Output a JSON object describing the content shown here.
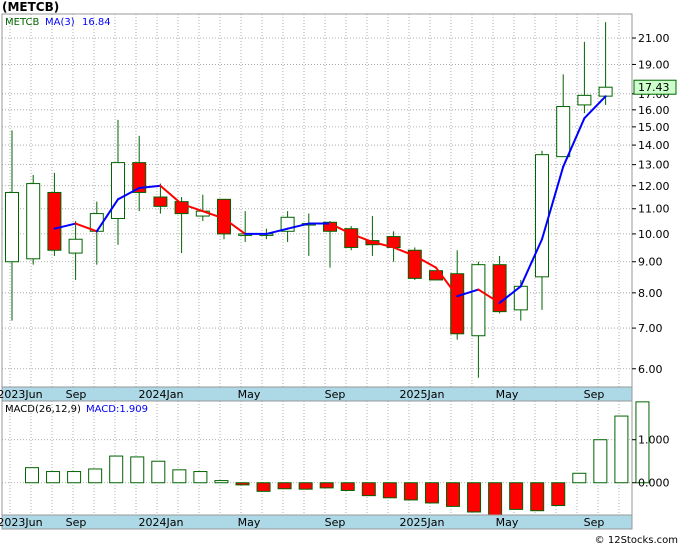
{
  "chart_data": {
    "type": "candlestick",
    "title": "(METCB)",
    "footer": "© 12Stocks.com",
    "x_labels": [
      "2023Jun",
      "Sep",
      "2024Jan",
      "May",
      "Sep",
      "2025Jan",
      "May",
      "Sep"
    ],
    "price_panel": {
      "y_scale": "log",
      "ylim": [
        5.6,
        23.0
      ],
      "y_ticks": [
        "21.00",
        "19.00",
        "17.00",
        "16.00",
        "15.00",
        "14.00",
        "13.00",
        "12.00",
        "11.00",
        "10.00",
        "9.00",
        "8.00",
        "7.00",
        "6.00"
      ],
      "current_price": "17.43",
      "legend": {
        "ticker": "METCB",
        "ma_label": "MA(3)",
        "ma_value": "16.84"
      },
      "colors": {
        "up": "#ffffff",
        "down": "#ff0000",
        "outline": "#006400",
        "ma_up": "#0000ff",
        "ma_down": "#ff0000"
      },
      "candles": [
        {
          "o": 9.0,
          "h": 14.8,
          "l": 7.2,
          "c": 11.7
        },
        {
          "o": 9.1,
          "h": 12.5,
          "l": 8.9,
          "c": 12.1
        },
        {
          "o": 11.7,
          "h": 12.6,
          "l": 9.2,
          "c": 9.4
        },
        {
          "o": 9.3,
          "h": 10.5,
          "l": 8.4,
          "c": 9.8
        },
        {
          "o": 10.1,
          "h": 11.3,
          "l": 8.9,
          "c": 10.8
        },
        {
          "o": 10.6,
          "h": 15.4,
          "l": 9.6,
          "c": 13.1
        },
        {
          "o": 13.1,
          "h": 14.5,
          "l": 10.9,
          "c": 11.7
        },
        {
          "o": 11.5,
          "h": 12.1,
          "l": 10.8,
          "c": 11.1
        },
        {
          "o": 11.3,
          "h": 11.5,
          "l": 9.3,
          "c": 10.8
        },
        {
          "o": 10.7,
          "h": 11.6,
          "l": 10.5,
          "c": 10.9
        },
        {
          "o": 11.4,
          "h": 11.4,
          "l": 9.8,
          "c": 10.0
        },
        {
          "o": 9.98,
          "h": 10.9,
          "l": 9.7,
          "c": 10.0
        },
        {
          "o": 9.95,
          "h": 10.2,
          "l": 9.8,
          "c": 10.0
        },
        {
          "o": 10.1,
          "h": 10.9,
          "l": 9.7,
          "c": 10.65
        },
        {
          "o": 10.4,
          "h": 10.8,
          "l": 9.2,
          "c": 10.4
        },
        {
          "o": 10.45,
          "h": 10.5,
          "l": 8.8,
          "c": 10.1
        },
        {
          "o": 10.2,
          "h": 10.3,
          "l": 9.4,
          "c": 9.5
        },
        {
          "o": 9.75,
          "h": 10.7,
          "l": 9.2,
          "c": 9.6
        },
        {
          "o": 9.9,
          "h": 10.1,
          "l": 9.0,
          "c": 9.5
        },
        {
          "o": 9.4,
          "h": 9.5,
          "l": 8.4,
          "c": 8.45
        },
        {
          "o": 8.7,
          "h": 8.7,
          "l": 8.4,
          "c": 8.4
        },
        {
          "o": 8.6,
          "h": 9.4,
          "l": 6.7,
          "c": 6.85
        },
        {
          "o": 6.8,
          "h": 9.0,
          "l": 5.8,
          "c": 8.9
        },
        {
          "o": 8.9,
          "h": 9.2,
          "l": 7.4,
          "c": 7.45
        },
        {
          "o": 7.5,
          "h": 8.4,
          "l": 7.2,
          "c": 8.2
        },
        {
          "o": 8.5,
          "h": 13.7,
          "l": 7.5,
          "c": 13.5
        },
        {
          "o": 13.4,
          "h": 18.3,
          "l": 13.4,
          "c": 16.2
        },
        {
          "o": 16.3,
          "h": 20.7,
          "l": 15.8,
          "c": 16.9
        },
        {
          "o": 16.85,
          "h": 22.3,
          "l": 16.3,
          "c": 17.43
        }
      ],
      "ma": [
        null,
        null,
        10.2,
        10.4,
        10.1,
        11.4,
        11.9,
        12.0,
        11.2,
        10.9,
        10.6,
        10.0,
        10.0,
        10.2,
        10.4,
        10.4,
        10.0,
        9.7,
        9.5,
        9.2,
        8.8,
        7.9,
        8.1,
        7.7,
        8.2,
        9.8,
        12.9,
        15.5,
        16.84
      ]
    },
    "macd_panel": {
      "label": "MACD(26,12,9)",
      "macd_label": "MACD:1.909",
      "ylim": [
        -0.75,
        1.9
      ],
      "y_ticks": [
        "1.000",
        "0.000"
      ],
      "colors": {
        "positive": "#ffffff",
        "negative": "#ff0000",
        "outline": "#006400"
      },
      "values": [
        0.35,
        0.26,
        0.26,
        0.32,
        0.62,
        0.6,
        0.5,
        0.3,
        0.26,
        0.05,
        -0.05,
        -0.2,
        -0.14,
        -0.15,
        -0.12,
        -0.18,
        -0.3,
        -0.35,
        -0.4,
        -0.47,
        -0.55,
        -0.68,
        -0.75,
        -0.62,
        -0.65,
        -0.53,
        0.22,
        1.0,
        1.55,
        1.88
      ]
    }
  }
}
